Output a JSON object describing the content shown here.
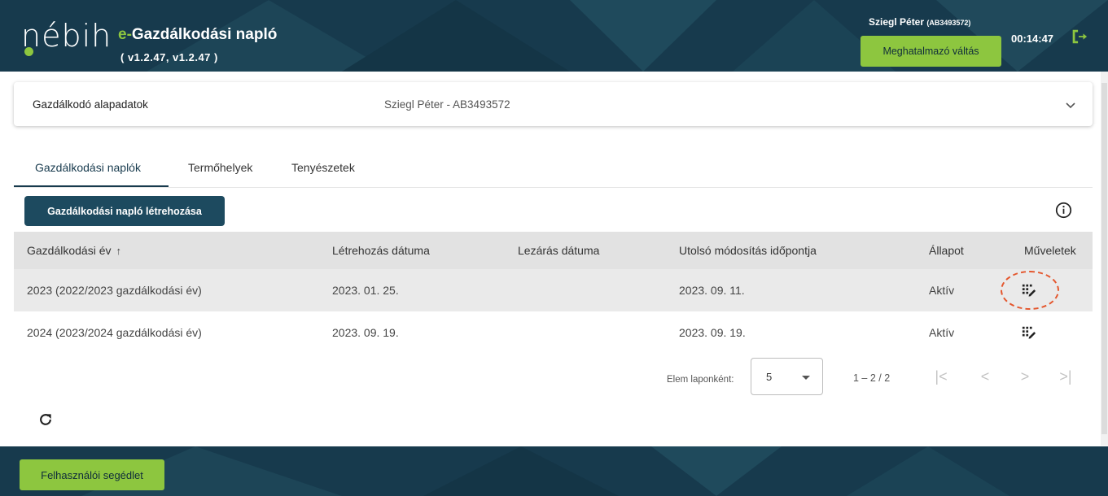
{
  "header": {
    "logo_text": "nébih",
    "app_title_prefix": "e-",
    "app_title": "Gazdálkodási napló",
    "version": "( v1.2.47, v1.2.47 )",
    "user_name": "Sziegl Péter",
    "user_id": "(AB3493572)",
    "switch_button": "Meghatalmazó váltás",
    "session_timer": "00:14:47",
    "logout_icon": "logout-icon",
    "accent_color": "#8dc63f",
    "brand_color": "#173a4d"
  },
  "farmer_card": {
    "label": "Gazdálkodó alapadatok",
    "value": "Sziegl Péter - AB3493572",
    "expand_icon": "chevron-down-icon"
  },
  "tabs": [
    {
      "label": "Gazdálkodási naplók",
      "active": true
    },
    {
      "label": "Termőhelyek",
      "active": false
    },
    {
      "label": "Tenyészetek",
      "active": false
    }
  ],
  "create_button": "Gazdálkodási napló létrehozása",
  "info_icon": "info-icon",
  "table": {
    "columns": [
      "Gazdálkodási év",
      "Létrehozás dátuma",
      "Lezárás dátuma",
      "Utolsó módosítás időpontja",
      "Állapot",
      "Műveletek"
    ],
    "sort_indicator": "↑",
    "rows": [
      {
        "year": "2023 (2022/2023 gazdálkodási év)",
        "created": "2023. 01. 25.",
        "closed": "",
        "modified": "2023. 09. 11.",
        "status": "Aktív",
        "action_icon": "edit-journal-icon"
      },
      {
        "year": "2024 (2023/2024 gazdálkodási év)",
        "created": "2023. 09. 19.",
        "closed": "",
        "modified": "2023. 09. 19.",
        "status": "Aktív",
        "action_icon": "edit-journal-icon"
      }
    ]
  },
  "paginator": {
    "items_per_page_label": "Elem laponként:",
    "page_size": "5",
    "range": "1 – 2 / 2",
    "first": "|<",
    "prev": "<",
    "next": ">",
    "last": ">|"
  },
  "refresh_icon": "refresh-icon",
  "footer": {
    "help_button": "Felhasználói segédlet"
  }
}
